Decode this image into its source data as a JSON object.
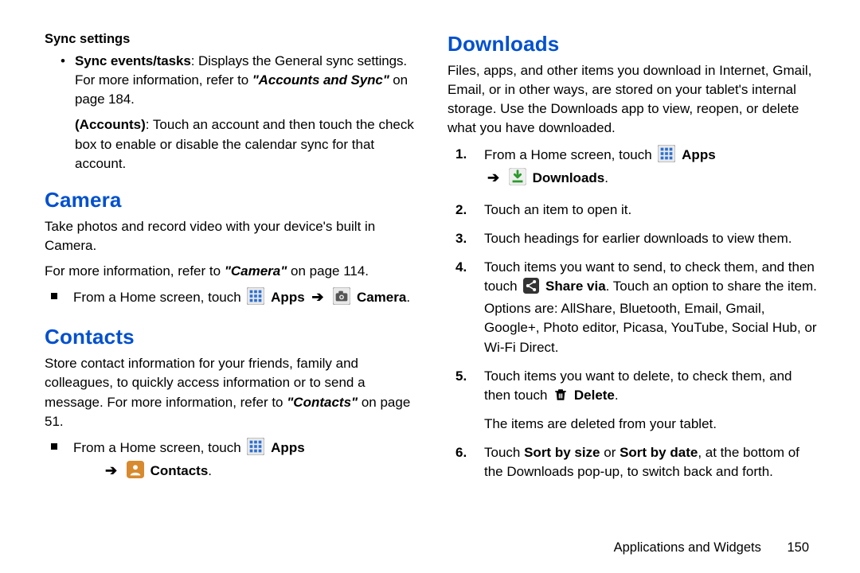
{
  "left": {
    "sync_heading": "Sync settings",
    "sync_bullet_lead": "Sync events/tasks",
    "sync_bullet_text1": ": Displays the General sync settings. For more information, refer to ",
    "sync_bullet_ital": "\"Accounts and Sync\"",
    "sync_bullet_text2": " on page 184.",
    "accounts_lead": "(Accounts)",
    "accounts_text": ": Touch an account and then touch the check box to enable or disable the calendar sync for that account.",
    "camera_h": "Camera",
    "camera_p1": "Take photos and record video with your device's built in Camera.",
    "camera_p2a": "For more information, refer to ",
    "camera_p2_ital": "\"Camera\"",
    "camera_p2b": " on page 114.",
    "camera_li_lead": "From a Home screen, touch ",
    "apps_label": "Apps",
    "camera_label": "Camera",
    "contacts_h": "Contacts",
    "contacts_p_a": "Store contact information for your friends, family and colleagues, to quickly access information or to send a message. For more information, refer to ",
    "contacts_p_ital": "\"Contacts\"",
    "contacts_p_b": " on page 51.",
    "contacts_li_lead": "From a Home screen, touch ",
    "contacts_label": "Contacts"
  },
  "right": {
    "downloads_h": "Downloads",
    "downloads_intro": "Files, apps, and other items you download in Internet, Gmail, Email, or in other ways, are stored on your tablet's internal storage. Use the Downloads app to view, reopen, or delete what you have downloaded.",
    "step1_lead": "From a Home screen, touch ",
    "step1_apps": "Apps",
    "step1_dl": "Downloads",
    "step2": "Touch an item to open it.",
    "step3": "Touch headings for earlier downloads to view them.",
    "step4_a": "Touch items you want to send, to check them, and then touch ",
    "step4_share": "Share via",
    "step4_b": ". Touch an option to share the item. Options are: AllShare, Bluetooth, Email, Gmail, Google+, Photo editor, Picasa, YouTube, Social Hub, or Wi-Fi Direct.",
    "step5_a": "Touch items you want to delete, to check them, and then touch ",
    "step5_delete": "Delete",
    "step5_b": ".",
    "step5_c": "The items are deleted from your tablet.",
    "step6_a": "Touch ",
    "step6_s1": "Sort by size",
    "step6_or": " or ",
    "step6_s2": "Sort by date",
    "step6_b": ", at the bottom of the Downloads pop-up, to switch back and forth."
  },
  "footer": {
    "section": "Applications and Widgets",
    "page": "150"
  },
  "numbers": {
    "n1": "1.",
    "n2": "2.",
    "n3": "3.",
    "n4": "4.",
    "n5": "5.",
    "n6": "6."
  }
}
